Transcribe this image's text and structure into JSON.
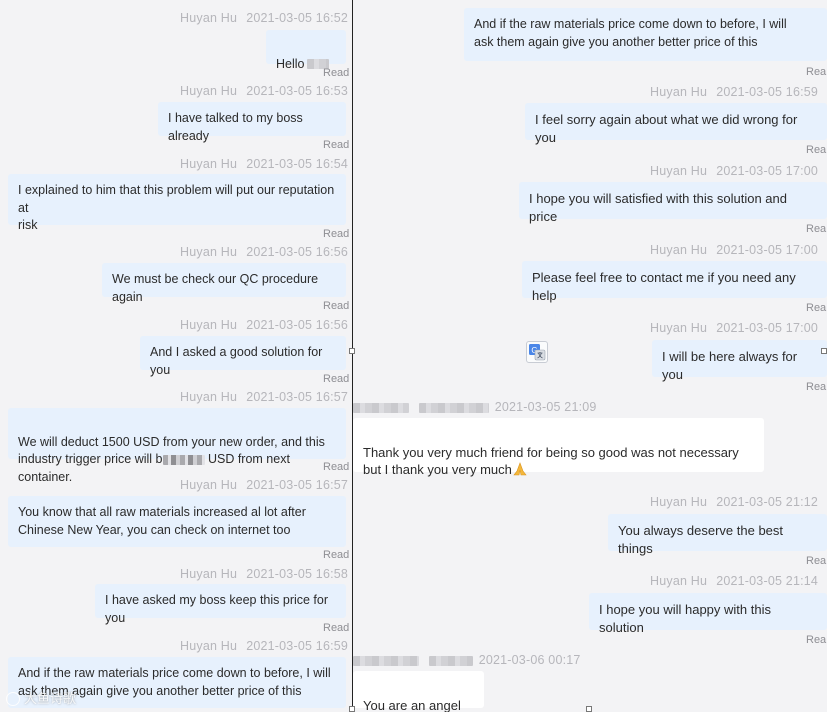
{
  "left": {
    "messages": [
      {
        "sender": "Huyan Hu",
        "time": "2021-03-05 16:52",
        "text": "Hello",
        "status": "Read"
      },
      {
        "sender": "Huyan Hu",
        "time": "2021-03-05 16:53",
        "text": "I have talked to my boss already",
        "status": "Read"
      },
      {
        "sender": "Huyan Hu",
        "time": "2021-03-05 16:54",
        "text": "I explained to him that this problem will put our reputation at\nrisk",
        "status": "Read"
      },
      {
        "sender": "Huyan Hu",
        "time": "2021-03-05 16:56",
        "text": "We must be check our QC procedure again",
        "status": "Read"
      },
      {
        "sender": "Huyan Hu",
        "time": "2021-03-05 16:56",
        "text": "And I asked a good solution for you",
        "status": "Read"
      },
      {
        "sender": "Huyan Hu",
        "time": "2021-03-05 16:57",
        "text_a": "We will deduct 1500 USD from your new order, and this\nindustry trigger price will b",
        "text_b": " USD from next container.",
        "status": "Read"
      },
      {
        "sender": "Huyan Hu",
        "time": "2021-03-05 16:57",
        "text": "You know that all raw materials increased al lot after\nChinese New Year, you can check on internet too",
        "status": "Read"
      },
      {
        "sender": "Huyan Hu",
        "time": "2021-03-05 16:58",
        "text": "I have asked my boss keep this price for you",
        "status": "Read"
      },
      {
        "sender": "Huyan Hu",
        "time": "2021-03-05 16:59",
        "text": "And if the raw materials price come down to before, I will\nask them again give you another better price of this"
      }
    ]
  },
  "right": {
    "messages": [
      {
        "text": "And if the raw materials price come down to before, I will\nask them again give you another better price of this",
        "status": "Rea"
      },
      {
        "sender": "Huyan Hu",
        "time": "2021-03-05 16:59",
        "text": "I feel sorry again about what we did wrong for you",
        "status": "Rea"
      },
      {
        "sender": "Huyan Hu",
        "time": "2021-03-05 17:00",
        "text": "I hope you will satisfied with this solution and price",
        "status": "Rea"
      },
      {
        "sender": "Huyan Hu",
        "time": "2021-03-05 17:00",
        "text": "Please feel free to contact me if you need any help",
        "status": "Rea"
      },
      {
        "sender": "Huyan Hu",
        "time": "2021-03-05 17:00",
        "text": "I will be here always for you",
        "status": "Rea"
      },
      {
        "time": "2021-03-05 21:09",
        "text": "Thank you very much friend for being so good was not necessary\nbut I thank you very much"
      },
      {
        "sender": "Huyan Hu",
        "time": "2021-03-05 21:12",
        "text": "You always deserve the best things",
        "status": "Rea"
      },
      {
        "sender": "Huyan Hu",
        "time": "2021-03-05 21:14",
        "text": "I hope you will happy with this solution",
        "status": "Rea"
      },
      {
        "time": "2021-03-06 00:17",
        "text": "You are an angel "
      }
    ]
  },
  "icons": {
    "translate": "translate-icon",
    "emoji": "folded-hands-emoji"
  },
  "watermark": {
    "text": "大鱼诗歌"
  }
}
